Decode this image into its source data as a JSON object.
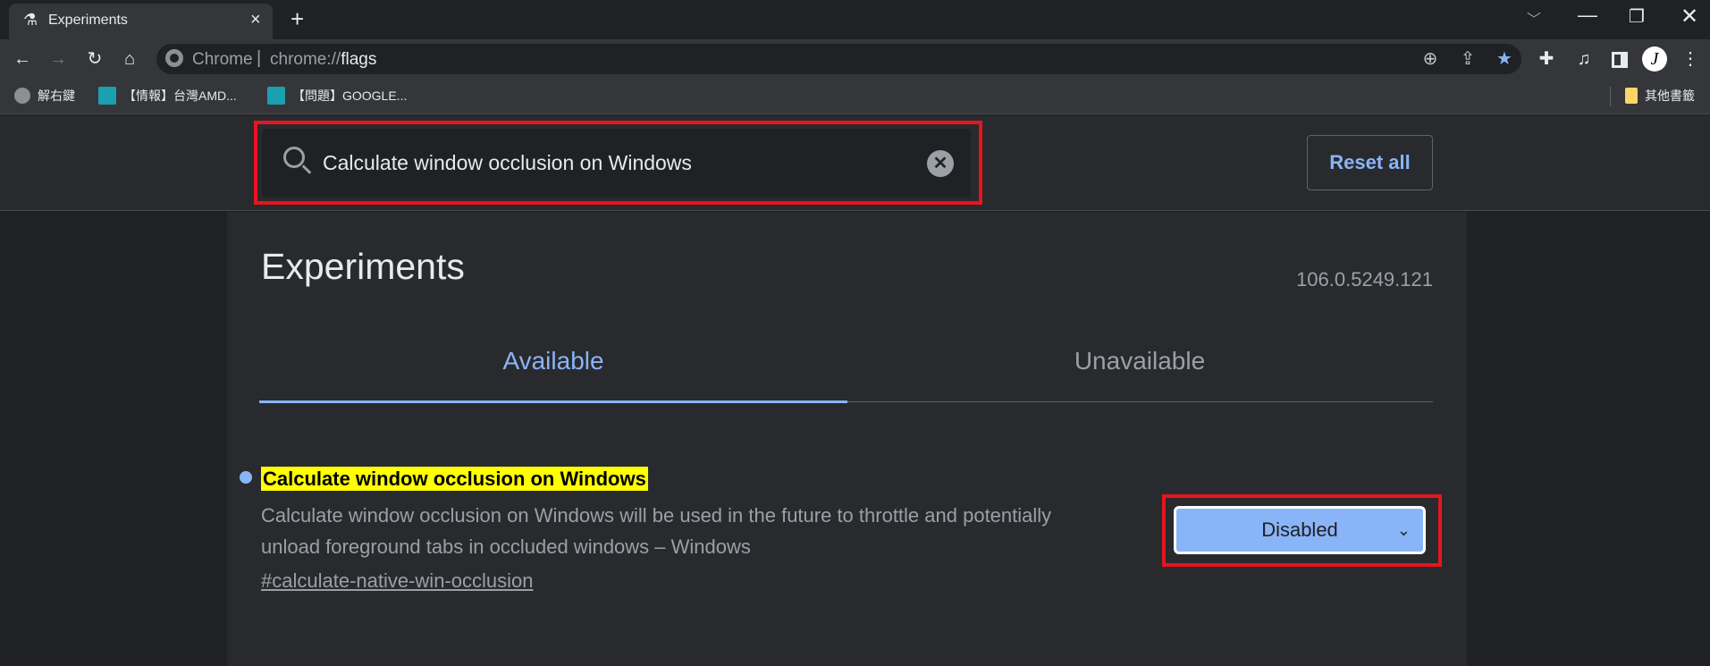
{
  "browser": {
    "tab_title": "Experiments",
    "tab_icon": "flask-icon",
    "new_tab": "+",
    "close_tab": "×",
    "omnibox": {
      "site_label": "Chrome",
      "separator": "|",
      "url_prefix": "chrome://",
      "url_path": "flags"
    },
    "bookmarks": [
      {
        "label": "解右鍵",
        "icon": "globe-icon"
      },
      {
        "label": "【情報】台灣AMD...",
        "icon": "site-favicon"
      },
      {
        "label": "【問題】GOOGLE...",
        "icon": "site-favicon"
      }
    ],
    "other_bookmarks": "其他書籤",
    "profile_initial": "J"
  },
  "search": {
    "value": "Calculate window occlusion on Windows",
    "placeholder": "Search flags"
  },
  "reset_all": "Reset all",
  "page": {
    "title": "Experiments",
    "version": "106.0.5249.121",
    "tabs": [
      {
        "label": "Available",
        "active": true
      },
      {
        "label": "Unavailable",
        "active": false
      }
    ]
  },
  "flag": {
    "title": "Calculate window occlusion on Windows",
    "description_line1": "Calculate window occlusion on Windows will be used in the future to throttle and potentially",
    "description_line2": "unload foreground tabs in occluded windows – Windows",
    "link": "#calculate-native-win-occlusion",
    "selected": "Disabled"
  },
  "colors": {
    "accent": "#8ab4f8",
    "highlight": "#ffff00",
    "annotation": "#e8141e"
  }
}
